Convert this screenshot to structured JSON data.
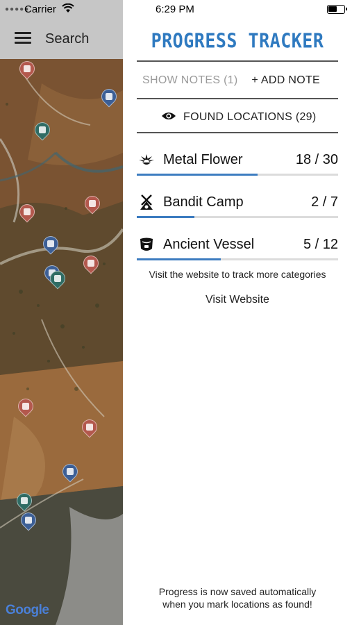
{
  "status_bar": {
    "carrier": "Carrier",
    "time": "6:29 PM"
  },
  "map": {
    "search_label": "Search",
    "attribution": "Google",
    "pin_colors": {
      "red": "#b3584d",
      "blue": "#3c5f96",
      "teal": "#2f6c64"
    }
  },
  "panel": {
    "title": "PROGRESS TRACKER",
    "title_color": "#2f7ac0",
    "show_notes": "SHOW NOTES (1)",
    "add_note": "+ ADD NOTE",
    "found_locations": "FOUND LOCATIONS (29)",
    "categories": [
      {
        "name": "Metal Flower",
        "count_text": "18 / 30",
        "found": 18,
        "total": 30,
        "icon": "metal-flower-icon"
      },
      {
        "name": "Bandit Camp",
        "count_text": "2 / 7",
        "found": 2,
        "total": 7,
        "icon": "bandit-camp-icon"
      },
      {
        "name": "Ancient Vessel",
        "count_text": "5 / 12",
        "found": 5,
        "total": 12,
        "icon": "ancient-vessel-icon"
      }
    ],
    "progress_color": "#3d7cc0",
    "visit_hint": "Visit the website to track more categories",
    "visit_link": "Visit Website",
    "autosave_line1": "Progress is now saved automatically",
    "autosave_line2": "when you mark locations as found!"
  }
}
